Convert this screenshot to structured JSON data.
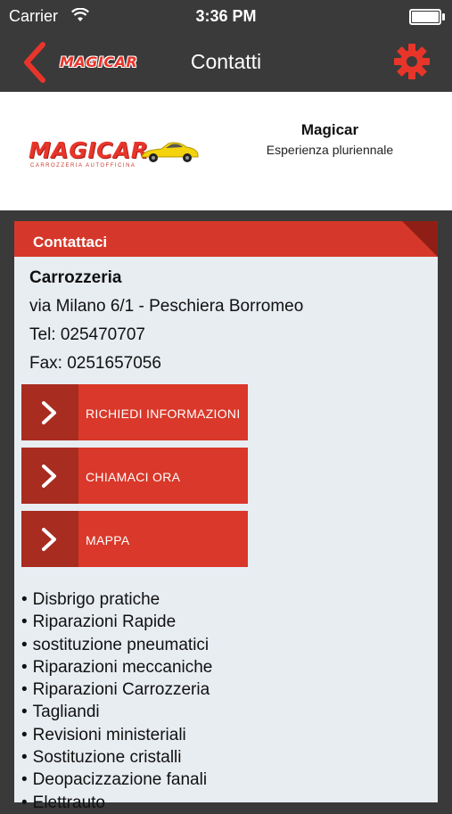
{
  "status_bar": {
    "carrier": "Carrier",
    "time": "3:36 PM"
  },
  "navbar": {
    "logo_text": "MAGICAR",
    "title": "Contatti"
  },
  "header_card": {
    "logo_text": "MAGICAR",
    "logo_subtitle": "CARROZZERIA AUTOFFICINA",
    "company_name": "Magicar",
    "company_tagline": "Esperienza pluriennale"
  },
  "contact": {
    "section_title": "Contattaci",
    "name": "Carrozzeria",
    "address": "via Milano 6/1 - Peschiera Borromeo",
    "phone": "Tel: 025470707",
    "fax": "Fax: 0251657056",
    "actions": [
      {
        "label": "RICHIEDI INFORMAZIONI"
      },
      {
        "label": "CHIAMACI ORA"
      },
      {
        "label": "MAPPA"
      }
    ],
    "services": [
      "Disbrigo pratiche",
      "Riparazioni Rapide",
      "sostituzione pneumatici",
      "Riparazioni meccaniche",
      "Riparazioni Carrozzeria",
      "Tagliandi",
      "Revisioni ministeriali",
      "Sostituzione cristalli",
      "Deopacizzazione fanali",
      "Elettrauto"
    ]
  },
  "colors": {
    "accent": "#d9382a",
    "accent_dark": "#a82c20",
    "navbar": "#3a3a3a",
    "panel": "#e8edf2"
  },
  "icons": {
    "back": "chevron-left-icon",
    "settings": "gear-icon",
    "action": "chevron-right-icon"
  }
}
